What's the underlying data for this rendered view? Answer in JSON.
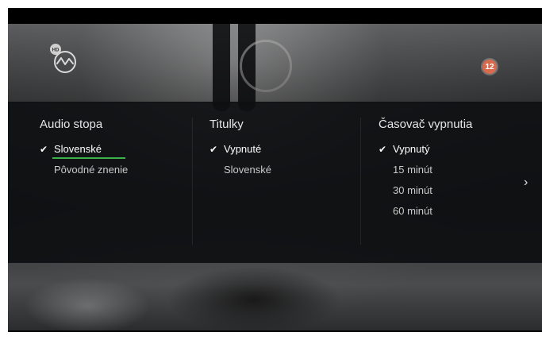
{
  "channel": {
    "badge": "HD",
    "logo_icon": "markiza-logo-icon"
  },
  "age_rating": "12",
  "columns": {
    "audio": {
      "title": "Audio stopa",
      "options": [
        "Slovenské",
        "Pôvodné znenie"
      ],
      "selected": "Slovenské"
    },
    "subtitles": {
      "title": "Titulky",
      "options": [
        "Vypnuté",
        "Slovenské"
      ],
      "selected": "Vypnuté"
    },
    "sleep_timer": {
      "title": "Časovač vypnutia",
      "options": [
        "Vypnutý",
        "15 minút",
        "30 minút",
        "60 minút"
      ],
      "selected": "Vypnutý"
    }
  },
  "next_icon": "chevron-right-icon",
  "colors": {
    "accent_underline": "#3cb24a",
    "age_badge": "#d86a4e"
  }
}
